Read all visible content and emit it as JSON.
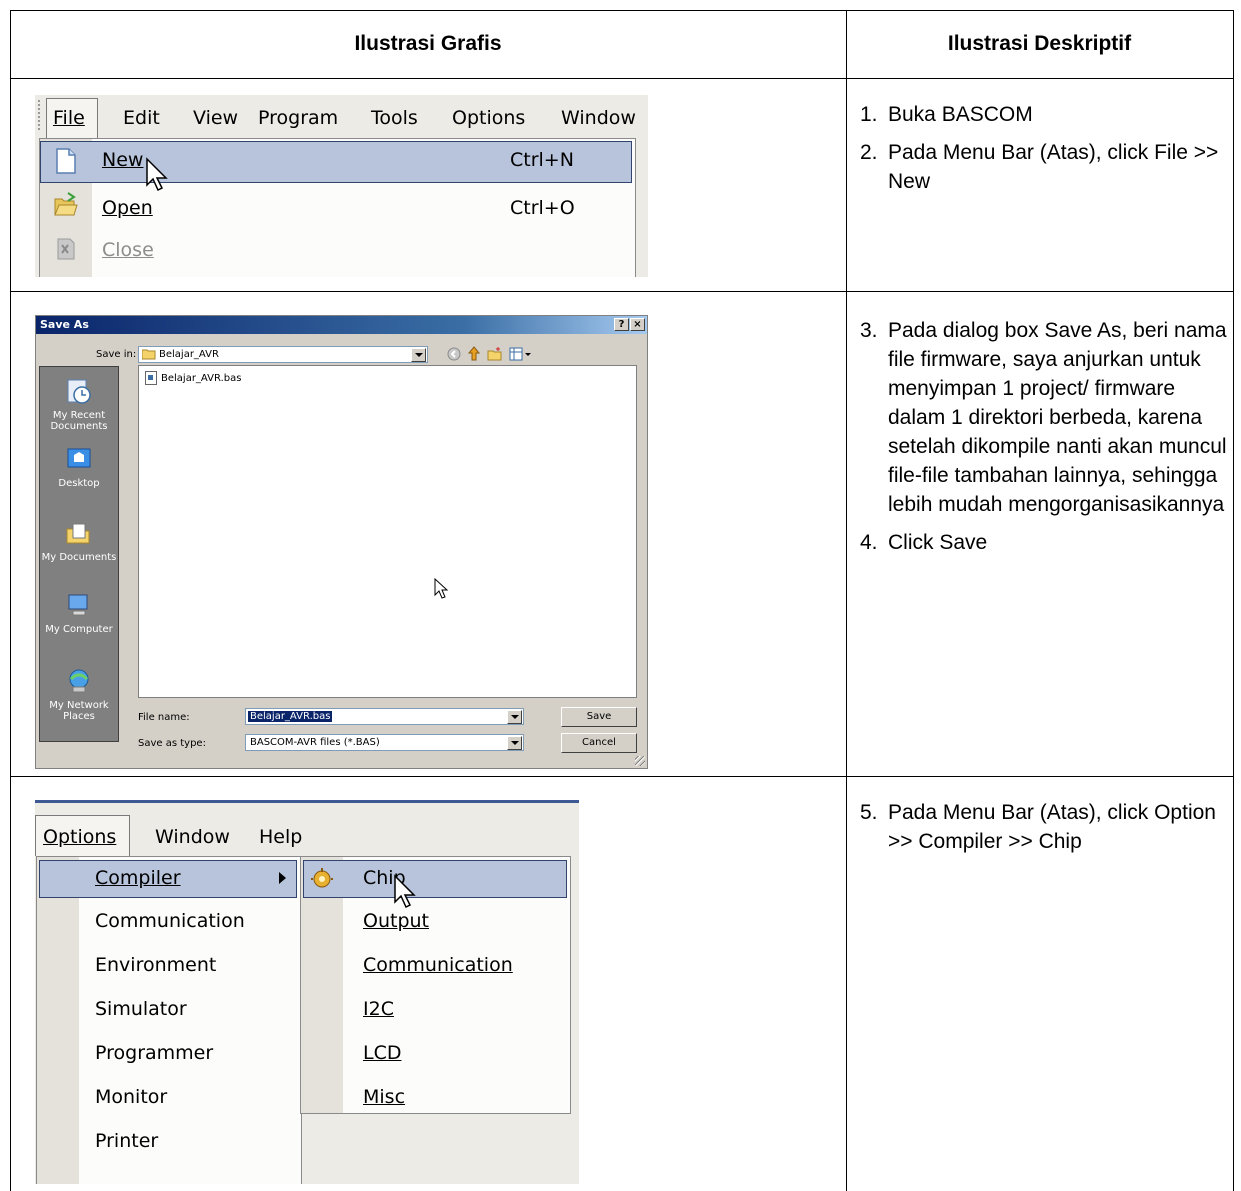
{
  "table": {
    "header_left": "Ilustrasi Grafis",
    "header_right": "Ilustrasi Deskriptif"
  },
  "row1": {
    "menu_bar": [
      "File",
      "Edit",
      "View",
      "Program",
      "Tools",
      "Options",
      "Window"
    ],
    "dropdown": [
      {
        "label": "New",
        "shortcut": "Ctrl+N",
        "icon": "new-file-icon",
        "highlighted": true
      },
      {
        "label": "Open",
        "shortcut": "Ctrl+O",
        "icon": "open-folder-icon",
        "highlighted": false
      },
      {
        "label": "Close",
        "shortcut": "",
        "icon": "close-doc-icon",
        "disabled": true
      }
    ],
    "steps": [
      {
        "num": "1.",
        "text": "Buka BASCOM"
      },
      {
        "num": "2.",
        "text": "Pada Menu Bar (Atas), click File >> New"
      }
    ]
  },
  "row2": {
    "dialog": {
      "title": "Save As",
      "title_buttons": [
        "?",
        "×"
      ],
      "save_in_label": "Save in:",
      "save_in_value": "Belajar_AVR",
      "places": [
        "My Recent Documents",
        "Desktop",
        "My Documents",
        "My Computer",
        "My Network Places"
      ],
      "files": [
        "Belajar_AVR.bas"
      ],
      "file_name_label": "File name:",
      "file_name_value": "Belajar_AVR.bas",
      "save_as_type_label": "Save as type:",
      "save_as_type_value": "BASCOM-AVR files (*.BAS)",
      "save_button": "Save",
      "cancel_button": "Cancel"
    },
    "steps": [
      {
        "num": "3.",
        "text": "Pada dialog box Save As, beri nama file firmware, saya anjurkan untuk menyimpan 1 project/ firmware dalam 1 direktori berbeda, karena setelah dikompile nanti akan muncul file-file tambahan lainnya, sehingga lebih mudah mengorganisasikannya"
      },
      {
        "num": "4.",
        "text": "Click Save"
      }
    ]
  },
  "row3": {
    "menu_bar": [
      "Options",
      "Window",
      "Help"
    ],
    "options_menu": [
      "Compiler",
      "Communication",
      "Environment",
      "Simulator",
      "Programmer",
      "Monitor",
      "Printer"
    ],
    "compiler_submenu": [
      "Chip",
      "Output",
      "Communication",
      "I2C",
      "LCD",
      "Misc"
    ],
    "steps": [
      {
        "num": "5.",
        "text": "Pada Menu Bar (Atas), click Option >> Compiler >> Chip"
      }
    ]
  },
  "colors": {
    "menu_highlight": "#b7c4db",
    "menu_highlight_border": "#30446e",
    "dialog_title_bar": "#0a246a",
    "dialog_face": "#d4d0c8",
    "places_bar": "#808080"
  }
}
